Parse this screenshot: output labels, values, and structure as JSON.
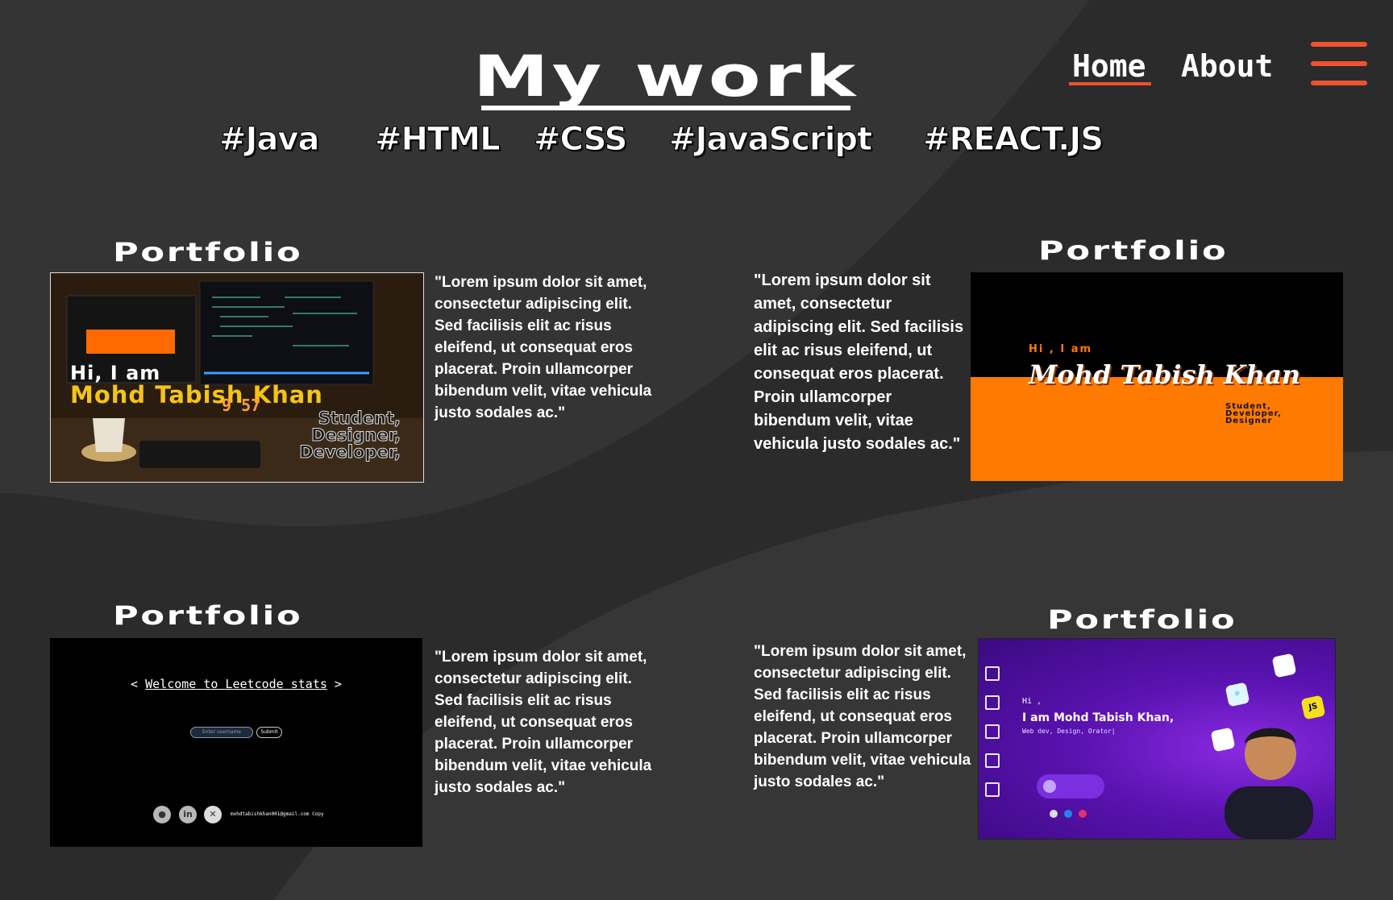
{
  "header": {
    "title": "My work",
    "nav": {
      "home": "Home",
      "about": "About"
    },
    "menu_icon": "hamburger-menu-icon"
  },
  "tags": [
    "#Java",
    "#HTML",
    "#CSS",
    "#JavaScript",
    "#REACT.JS"
  ],
  "projects": [
    {
      "title": "Portfolio",
      "description": "\"Lorem ipsum dolor sit amet, consectetur adipiscing elit. Sed facilisis elit ac risus eleifend, ut consequat eros placerat. Proin ullamcorper bibendum velit, vitae vehicula justo sodales ac.\"",
      "preview": {
        "greeting": "Hi, I am",
        "name": "Mohd Tabish Khan",
        "role_lines": [
          "Student,",
          "Designer,",
          "Developer,"
        ],
        "clock": "9 57"
      }
    },
    {
      "title": "Portfolio",
      "description": "\"Lorem ipsum dolor sit amet, consectetur adipiscing elit. Sed facilisis elit ac risus eleifend, ut consequat eros placerat. Proin ullamcorper bibendum velit, vitae vehicula justo sodales ac.\"",
      "preview": {
        "greeting": "Hi , I am",
        "name": "Mohd Tabish Khan",
        "role_lines": [
          "Student,",
          "Developer,",
          "Designer"
        ]
      }
    },
    {
      "title": "Portfolio",
      "description": "\"Lorem ipsum dolor sit amet, consectetur adipiscing elit. Sed facilisis elit ac risus eleifend, ut consequat eros placerat. Proin ullamcorper bibendum velit, vitae vehicula justo sodales ac.\"",
      "preview": {
        "welcome": "Welcome to Leetcode stats",
        "input_placeholder": "Enter username",
        "submit": "Submit",
        "email": "mohdtabishkhan001@gmail.com  Copy"
      }
    },
    {
      "title": "Portfolio",
      "description": "\"Lorem ipsum dolor sit amet, consectetur adipiscing elit. Sed facilisis elit ac risus eleifend, ut consequat eros placerat. Proin ullamcorper bibendum velit, vitae vehicula justo sodales ac.\"",
      "preview": {
        "greeting": "Hi ,",
        "name": "I am Mohd Tabish Khan,",
        "subtitle": "Web dev, Design, Orator|",
        "chip_js": "JS"
      }
    }
  ],
  "colors": {
    "background": "#2b2b2b",
    "accent": "#f0522f",
    "orange": "#ff7a00",
    "purple": "#5a12b0"
  }
}
